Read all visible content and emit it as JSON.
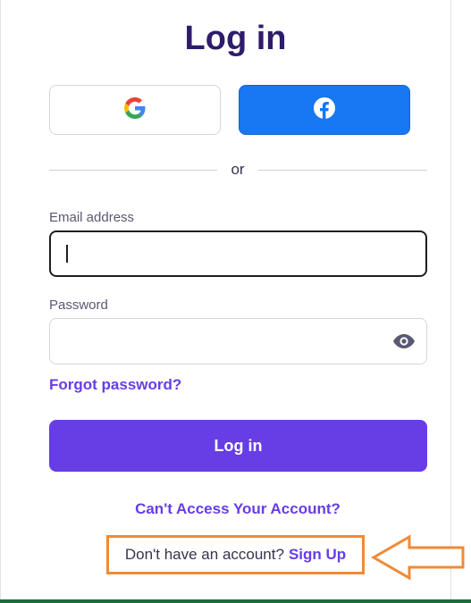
{
  "page": {
    "title": "Log in"
  },
  "social": {
    "google_icon": "google-g-icon",
    "facebook_icon": "facebook-f-icon",
    "facebook_color": "#1877f2"
  },
  "divider": {
    "text": "or"
  },
  "form": {
    "email_label": "Email address",
    "email_value": "",
    "password_label": "Password",
    "password_value": "",
    "password_toggle_icon": "eye-icon",
    "forgot_password": "Forgot password?",
    "login_button": "Log in"
  },
  "links": {
    "cant_access": "Can't Access Your Account?",
    "no_account_prompt": "Don't have an account?",
    "sign_up": "Sign Up"
  },
  "colors": {
    "brand": "#673de6",
    "title": "#2f1c6a",
    "annotation": "#f08a36"
  }
}
